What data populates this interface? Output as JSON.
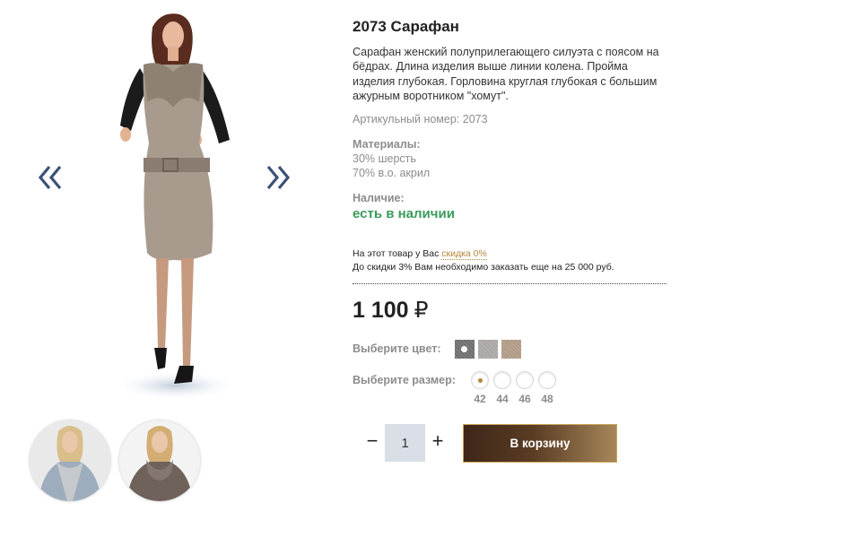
{
  "gallery": {
    "prev_icon": "double-chevron-left-icon",
    "next_icon": "double-chevron-right-icon",
    "thumbnails": [
      "thumbnail-grey-scarf",
      "thumbnail-brown-sweater"
    ]
  },
  "product": {
    "title": "2073 Сарафан",
    "description": "Сарафан женский полуприлегающего силуэта с поясом на бёдрах. Длина изделия выше линии колена. Пройма изделия глубокая. Горловина круглая глубокая с большим ажурным воротником \"хомут\".",
    "article": "Артикульный номер: 2073",
    "materials_label": "Материалы:",
    "materials": [
      "30% шерсть",
      "70% в.о. акрил"
    ],
    "availability_label": "Наличие:",
    "availability_value": "есть в наличии",
    "discount_prefix": "На этот товар у Вас",
    "discount_link": "скидка 0%",
    "discount_note": "До скидки 3% Вам необходимо заказать еще на 25 000 руб.",
    "price": "1 100",
    "currency": "₽"
  },
  "colors": {
    "label": "Выберите цвет:",
    "swatches": [
      {
        "name": "dark-grey",
        "hex": "#6e6e6e",
        "selected": true
      },
      {
        "name": "light-grey",
        "hex": "#a9a7a3",
        "selected": false
      },
      {
        "name": "beige",
        "hex": "#b09a86",
        "selected": false
      }
    ]
  },
  "sizes": {
    "label": "Выберите размер:",
    "options": [
      {
        "value": "42",
        "checked": true
      },
      {
        "value": "44",
        "checked": false
      },
      {
        "value": "46",
        "checked": false
      },
      {
        "value": "48",
        "checked": false
      }
    ]
  },
  "cart": {
    "minus": "−",
    "quantity": "1",
    "plus": "+",
    "button_label": "В корзину"
  },
  "accent": {
    "link": "#b3863c",
    "availability": "#3a9b5b"
  }
}
